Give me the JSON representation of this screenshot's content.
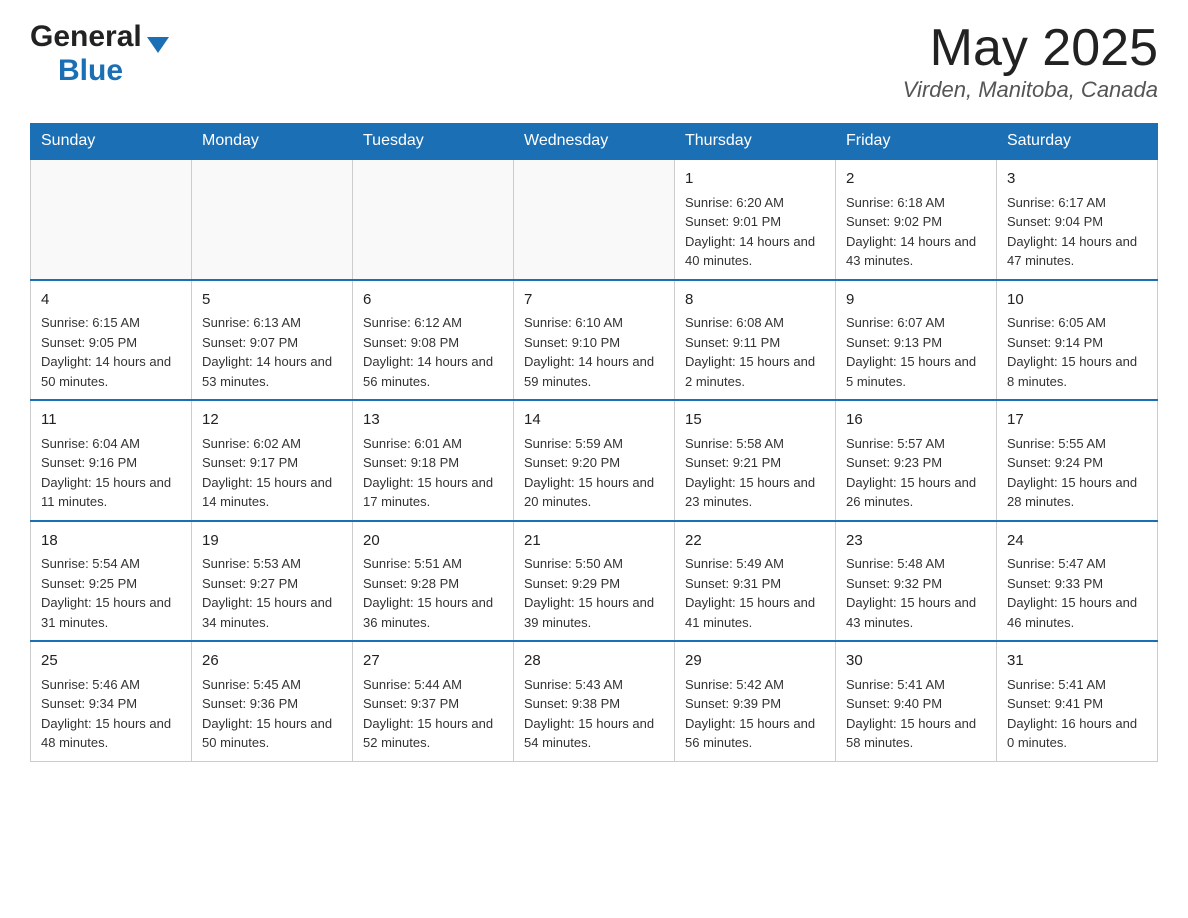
{
  "header": {
    "logo_general": "General",
    "logo_blue": "Blue",
    "month_year": "May 2025",
    "location": "Virden, Manitoba, Canada"
  },
  "days_of_week": [
    "Sunday",
    "Monday",
    "Tuesday",
    "Wednesday",
    "Thursday",
    "Friday",
    "Saturday"
  ],
  "weeks": [
    {
      "days": [
        {
          "num": "",
          "info": ""
        },
        {
          "num": "",
          "info": ""
        },
        {
          "num": "",
          "info": ""
        },
        {
          "num": "",
          "info": ""
        },
        {
          "num": "1",
          "info": "Sunrise: 6:20 AM\nSunset: 9:01 PM\nDaylight: 14 hours and 40 minutes."
        },
        {
          "num": "2",
          "info": "Sunrise: 6:18 AM\nSunset: 9:02 PM\nDaylight: 14 hours and 43 minutes."
        },
        {
          "num": "3",
          "info": "Sunrise: 6:17 AM\nSunset: 9:04 PM\nDaylight: 14 hours and 47 minutes."
        }
      ]
    },
    {
      "days": [
        {
          "num": "4",
          "info": "Sunrise: 6:15 AM\nSunset: 9:05 PM\nDaylight: 14 hours and 50 minutes."
        },
        {
          "num": "5",
          "info": "Sunrise: 6:13 AM\nSunset: 9:07 PM\nDaylight: 14 hours and 53 minutes."
        },
        {
          "num": "6",
          "info": "Sunrise: 6:12 AM\nSunset: 9:08 PM\nDaylight: 14 hours and 56 minutes."
        },
        {
          "num": "7",
          "info": "Sunrise: 6:10 AM\nSunset: 9:10 PM\nDaylight: 14 hours and 59 minutes."
        },
        {
          "num": "8",
          "info": "Sunrise: 6:08 AM\nSunset: 9:11 PM\nDaylight: 15 hours and 2 minutes."
        },
        {
          "num": "9",
          "info": "Sunrise: 6:07 AM\nSunset: 9:13 PM\nDaylight: 15 hours and 5 minutes."
        },
        {
          "num": "10",
          "info": "Sunrise: 6:05 AM\nSunset: 9:14 PM\nDaylight: 15 hours and 8 minutes."
        }
      ]
    },
    {
      "days": [
        {
          "num": "11",
          "info": "Sunrise: 6:04 AM\nSunset: 9:16 PM\nDaylight: 15 hours and 11 minutes."
        },
        {
          "num": "12",
          "info": "Sunrise: 6:02 AM\nSunset: 9:17 PM\nDaylight: 15 hours and 14 minutes."
        },
        {
          "num": "13",
          "info": "Sunrise: 6:01 AM\nSunset: 9:18 PM\nDaylight: 15 hours and 17 minutes."
        },
        {
          "num": "14",
          "info": "Sunrise: 5:59 AM\nSunset: 9:20 PM\nDaylight: 15 hours and 20 minutes."
        },
        {
          "num": "15",
          "info": "Sunrise: 5:58 AM\nSunset: 9:21 PM\nDaylight: 15 hours and 23 minutes."
        },
        {
          "num": "16",
          "info": "Sunrise: 5:57 AM\nSunset: 9:23 PM\nDaylight: 15 hours and 26 minutes."
        },
        {
          "num": "17",
          "info": "Sunrise: 5:55 AM\nSunset: 9:24 PM\nDaylight: 15 hours and 28 minutes."
        }
      ]
    },
    {
      "days": [
        {
          "num": "18",
          "info": "Sunrise: 5:54 AM\nSunset: 9:25 PM\nDaylight: 15 hours and 31 minutes."
        },
        {
          "num": "19",
          "info": "Sunrise: 5:53 AM\nSunset: 9:27 PM\nDaylight: 15 hours and 34 minutes."
        },
        {
          "num": "20",
          "info": "Sunrise: 5:51 AM\nSunset: 9:28 PM\nDaylight: 15 hours and 36 minutes."
        },
        {
          "num": "21",
          "info": "Sunrise: 5:50 AM\nSunset: 9:29 PM\nDaylight: 15 hours and 39 minutes."
        },
        {
          "num": "22",
          "info": "Sunrise: 5:49 AM\nSunset: 9:31 PM\nDaylight: 15 hours and 41 minutes."
        },
        {
          "num": "23",
          "info": "Sunrise: 5:48 AM\nSunset: 9:32 PM\nDaylight: 15 hours and 43 minutes."
        },
        {
          "num": "24",
          "info": "Sunrise: 5:47 AM\nSunset: 9:33 PM\nDaylight: 15 hours and 46 minutes."
        }
      ]
    },
    {
      "days": [
        {
          "num": "25",
          "info": "Sunrise: 5:46 AM\nSunset: 9:34 PM\nDaylight: 15 hours and 48 minutes."
        },
        {
          "num": "26",
          "info": "Sunrise: 5:45 AM\nSunset: 9:36 PM\nDaylight: 15 hours and 50 minutes."
        },
        {
          "num": "27",
          "info": "Sunrise: 5:44 AM\nSunset: 9:37 PM\nDaylight: 15 hours and 52 minutes."
        },
        {
          "num": "28",
          "info": "Sunrise: 5:43 AM\nSunset: 9:38 PM\nDaylight: 15 hours and 54 minutes."
        },
        {
          "num": "29",
          "info": "Sunrise: 5:42 AM\nSunset: 9:39 PM\nDaylight: 15 hours and 56 minutes."
        },
        {
          "num": "30",
          "info": "Sunrise: 5:41 AM\nSunset: 9:40 PM\nDaylight: 15 hours and 58 minutes."
        },
        {
          "num": "31",
          "info": "Sunrise: 5:41 AM\nSunset: 9:41 PM\nDaylight: 16 hours and 0 minutes."
        }
      ]
    }
  ]
}
